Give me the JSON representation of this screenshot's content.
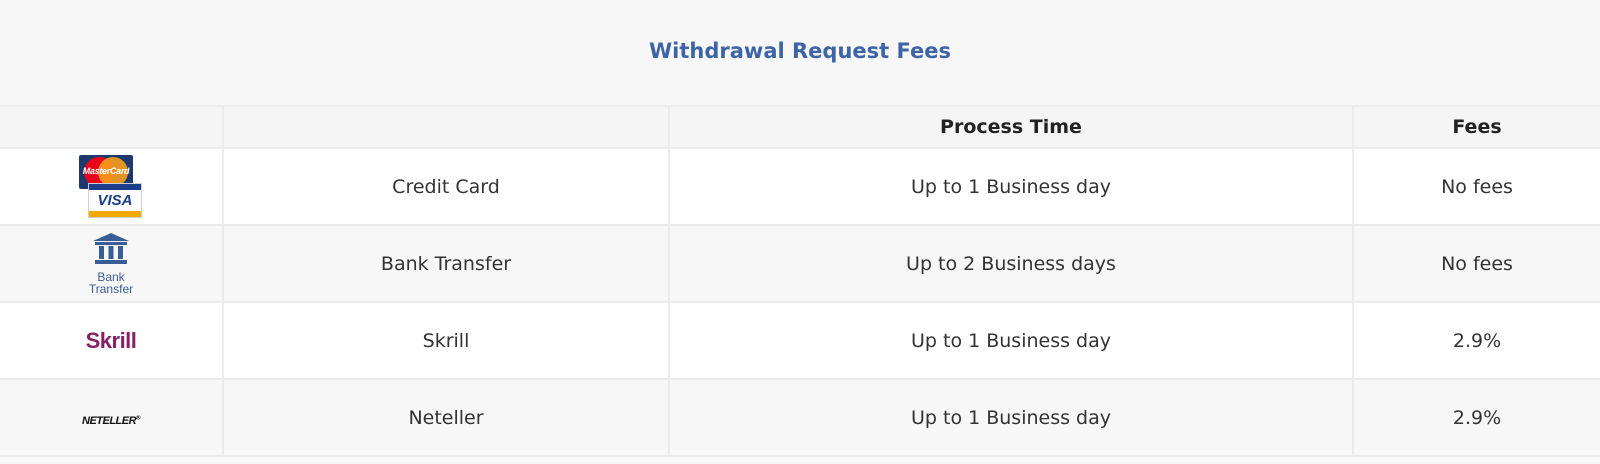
{
  "page": {
    "title": "Withdrawal Request Fees"
  },
  "table": {
    "headers": [
      "",
      "",
      "Process Time",
      "Fees"
    ],
    "rows": [
      {
        "logo": "credit-card-logo",
        "logo_text": [
          "MasterCard",
          "VISA"
        ],
        "method": "Credit Card",
        "process_time": "Up to 1 Business day",
        "fees": "No fees"
      },
      {
        "logo": "bank-transfer-logo",
        "logo_text": [
          "Bank",
          "Transfer"
        ],
        "method": "Bank Transfer",
        "process_time": "Up to 2 Business days",
        "fees": "No fees"
      },
      {
        "logo": "skrill-logo",
        "logo_text": [
          "Skrill"
        ],
        "method": "Skrill",
        "process_time": "Up to 1 Business day",
        "fees": "2.9%"
      },
      {
        "logo": "neteller-logo",
        "logo_text": [
          "NETELLER"
        ],
        "method": "Neteller",
        "process_time": "Up to 1 Business day",
        "fees": "2.9%"
      }
    ]
  },
  "colors": {
    "title": "#3e64a8",
    "skrill": "#862165",
    "bank": "#3a5d95",
    "visa_blue": "#1a3e8c",
    "visa_gold": "#f2a900"
  }
}
